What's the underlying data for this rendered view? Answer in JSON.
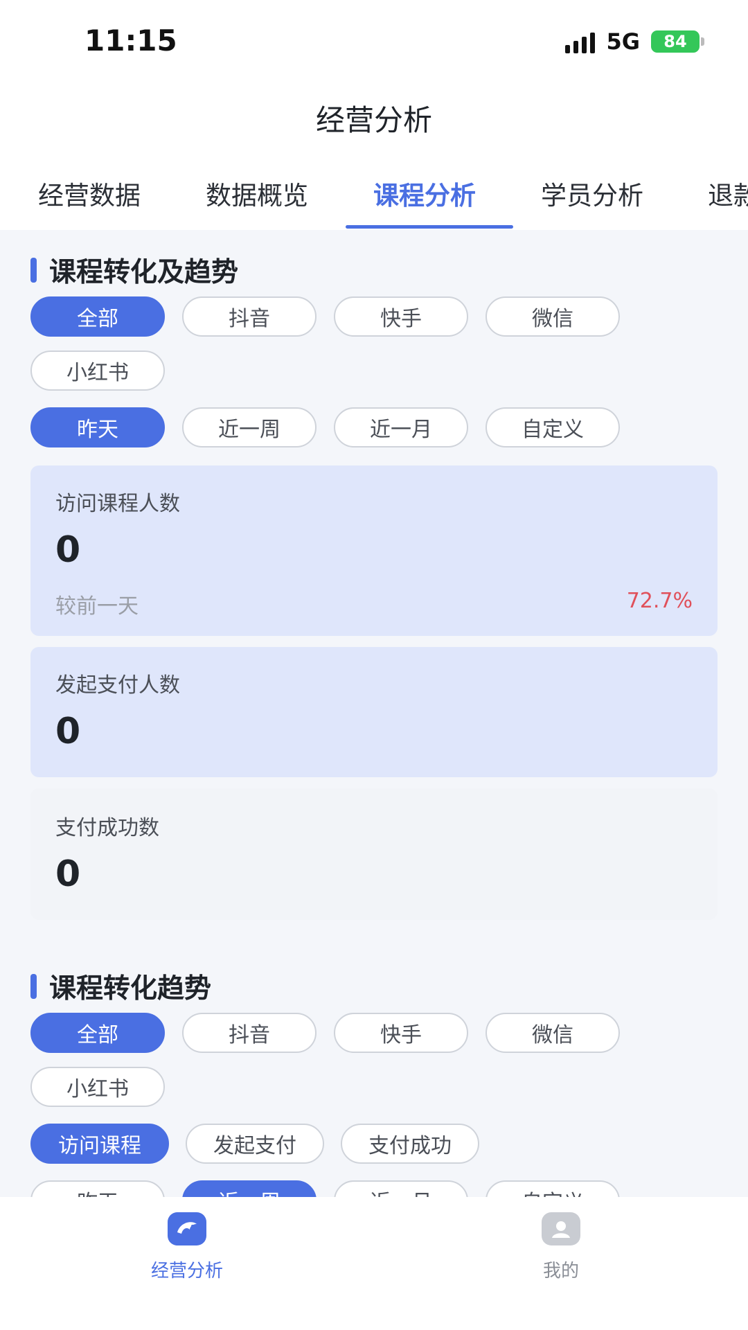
{
  "status_bar": {
    "time": "11:15",
    "network": "5G",
    "battery": "84"
  },
  "header": {
    "title": "经营分析"
  },
  "tabs": [
    {
      "label": "经营数据"
    },
    {
      "label": "数据概览"
    },
    {
      "label": "课程分析",
      "active": true
    },
    {
      "label": "学员分析"
    },
    {
      "label": "退款"
    }
  ],
  "section1": {
    "title": "课程转化及趋势",
    "platform_filters": [
      "全部",
      "抖音",
      "快手",
      "微信",
      "小红书"
    ],
    "platform_active": "全部",
    "time_filters": [
      "昨天",
      "近一周",
      "近一月",
      "自定义"
    ],
    "time_active": "昨天",
    "metrics": [
      {
        "label": "访问课程人数",
        "value": "0",
        "compare_label": "较前一天",
        "change": "72.7%"
      },
      {
        "label": "发起支付人数",
        "value": "0"
      },
      {
        "label": "支付成功数",
        "value": "0"
      }
    ]
  },
  "section2": {
    "title": "课程转化趋势",
    "platform_filters": [
      "全部",
      "抖音",
      "快手",
      "微信",
      "小红书"
    ],
    "platform_active": "全部",
    "metric_filters": [
      "访问课程",
      "发起支付",
      "支付成功"
    ],
    "metric_active": "访问课程",
    "time_filters": [
      "昨天",
      "近一周",
      "近一月",
      "自定义"
    ],
    "time_active": "近一周"
  },
  "bottom_nav": [
    {
      "label": "经营分析",
      "icon": "dolphin-logo-icon",
      "active": true
    },
    {
      "label": "我的",
      "icon": "profile-icon",
      "active": false
    }
  ],
  "colors": {
    "accent": "#4a6fe2",
    "negative": "#e0505a",
    "battery": "#34c759"
  }
}
